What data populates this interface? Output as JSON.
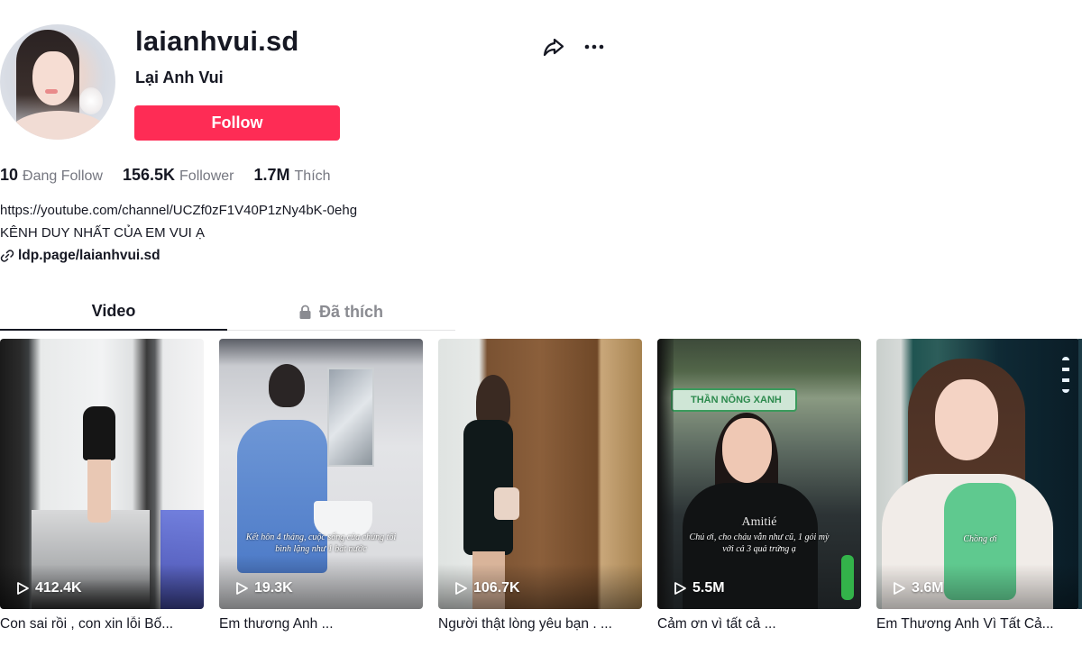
{
  "profile": {
    "username": "laianhvui.sd",
    "nickname": "Lại Anh Vui",
    "follow_label": "Follow",
    "share_icon": "share-arrow-icon",
    "more_icon": "more-horizontal-icon"
  },
  "stats": [
    {
      "value": "10",
      "label": "Đang Follow"
    },
    {
      "value": "156.5K",
      "label": "Follower"
    },
    {
      "value": "1.7M",
      "label": "Thích"
    }
  ],
  "bio": {
    "line1": "https://youtube.com/channel/UCZf0zF1V40P1zNy4bK-0ehg",
    "line2": "KÊNH DUY NHẤT CỦA EM VUI Ạ",
    "link_icon": "link-icon",
    "link": "ldp.page/laianhvui.sd"
  },
  "tabs": [
    {
      "label": "Video",
      "active": true
    },
    {
      "label": "Đã thích",
      "active": false,
      "icon": "lock-icon"
    }
  ],
  "videos": [
    {
      "views": "412.4K",
      "caption": "Con sai rồi , con xin lỗi Bố...",
      "overlay": ""
    },
    {
      "views": "19.3K",
      "caption": "Em thương Anh ...",
      "overlay": "Kết hôn 4 tháng, cuộc sống của chúng tôi\nbình lặng như 1 bát nước"
    },
    {
      "views": "106.7K",
      "caption": "Người thật lòng yêu bạn . ...",
      "overlay": ""
    },
    {
      "views": "5.5M",
      "caption": "Cảm ơn vì tất cả ...",
      "overlay": "Chú ơi, cho cháu vẫn như cũ, 1 gói mỳ\nvới cả 3 quả trứng ạ",
      "sign": "THẦN NÔNG XANH",
      "shirt_text": "Amitié"
    },
    {
      "views": "3.6M",
      "caption": "Em Thương Anh Vì Tất Cả...",
      "overlay": "Chồng ơi"
    }
  ],
  "colors": {
    "accent": "#fe2c55",
    "text": "#161823",
    "muted": "#757780"
  }
}
